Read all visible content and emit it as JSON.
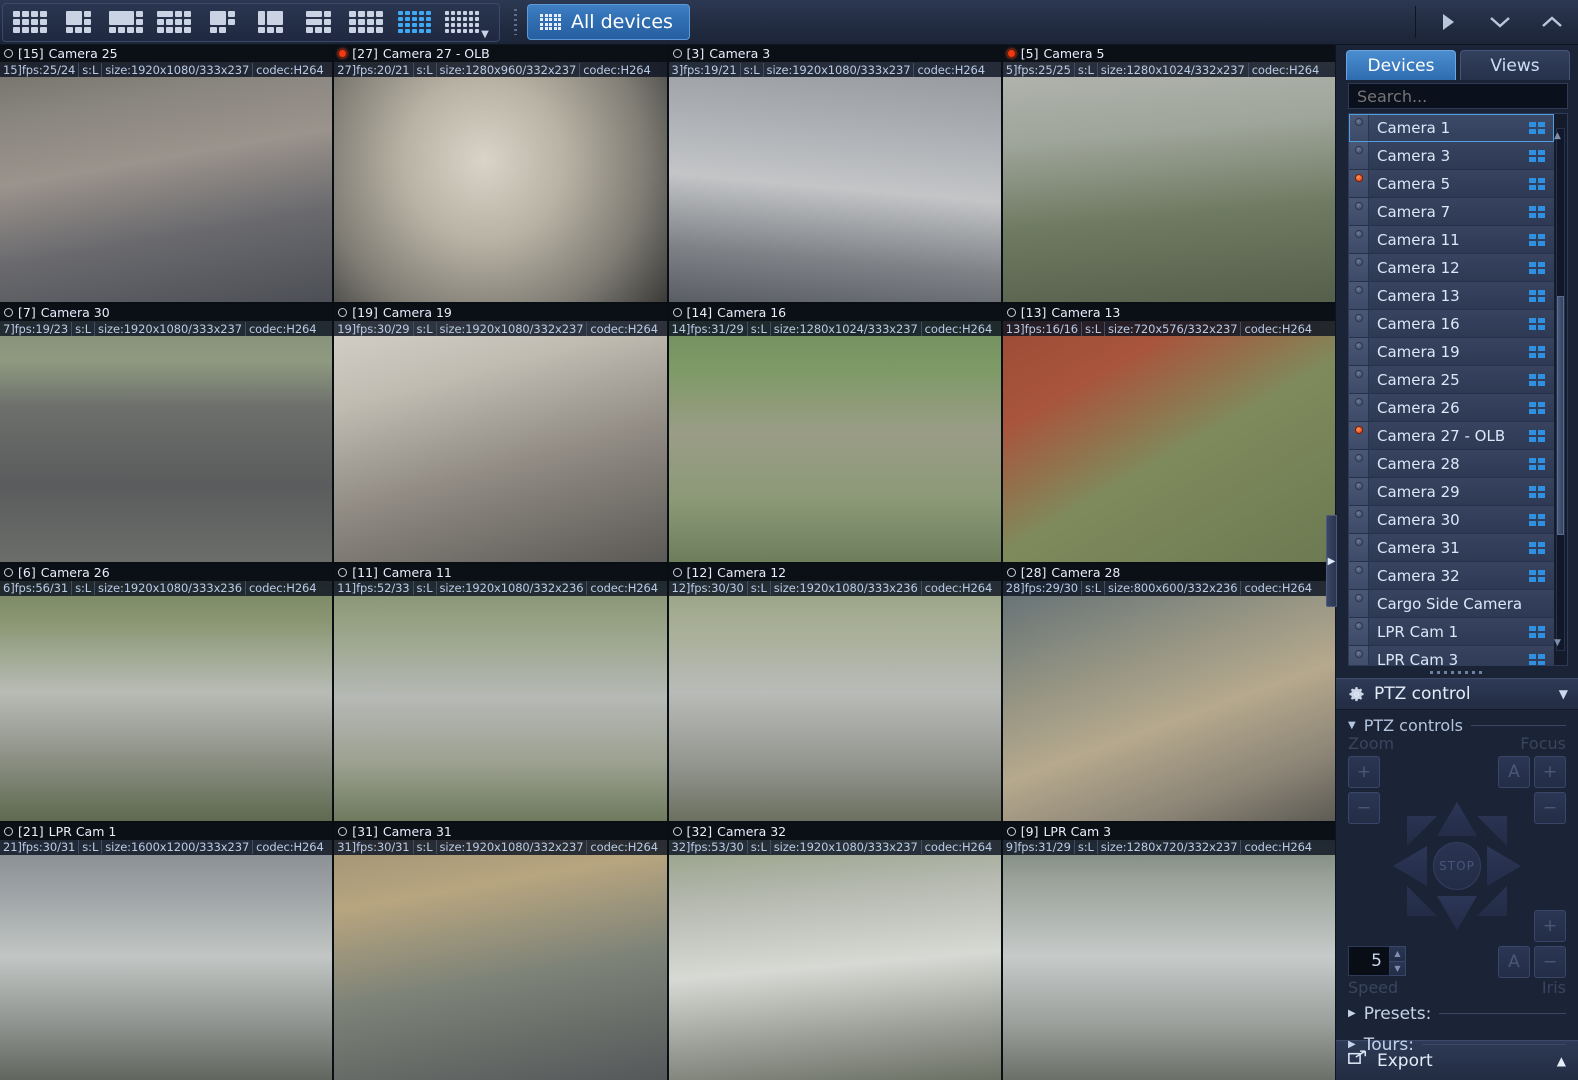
{
  "toolbar": {
    "layout_buttons": [
      {
        "name": "layout-4x3",
        "cols": 4,
        "rows": 3,
        "active": false
      },
      {
        "name": "layout-1plus5",
        "cols": 3,
        "rows": 3,
        "active": false
      },
      {
        "name": "layout-1plus7",
        "cols": 4,
        "rows": 3,
        "active": false
      },
      {
        "name": "layout-3x4-mixed",
        "cols": 4,
        "rows": 3,
        "active": false
      },
      {
        "name": "layout-1plus3",
        "cols": 3,
        "rows": 3,
        "active": false
      },
      {
        "name": "layout-2plus4",
        "cols": 3,
        "rows": 3,
        "active": false
      },
      {
        "name": "layout-2x2-mixed",
        "cols": 3,
        "rows": 3,
        "active": false
      },
      {
        "name": "layout-3x3",
        "cols": 4,
        "rows": 3,
        "active": false
      },
      {
        "name": "layout-4x4",
        "cols": 5,
        "rows": 4,
        "active": true
      },
      {
        "name": "layout-more",
        "cols": 6,
        "rows": 4,
        "active": false
      }
    ],
    "all_devices_label": "All devices",
    "play_icon": "play-icon",
    "collapse_down_icon": "chevron-down-icon",
    "collapse_up_icon": "chevron-up-icon",
    "accent": "#2f6cb0",
    "active_layout_color": "#3fa9f5"
  },
  "video_grid": {
    "rows": 4,
    "cols": 4,
    "cells": [
      {
        "channel": "[15]",
        "title": "Camera 25",
        "recording": false,
        "selected": false,
        "stats": [
          "15]fps:25/24",
          "s:L",
          "size:1920x1080/333x237",
          "codec:H264"
        ],
        "stats_full": "[15]fps:25/24 |s:L|size:1920x1080/333x237 |codec:H264",
        "scene": "escalator-crowd"
      },
      {
        "channel": "[27]",
        "title": "Camera 27 - OLB",
        "recording": true,
        "selected": false,
        "stats": [
          "27]fps:20/21",
          "s:L",
          "size:1280x960/332x237",
          "codec:H264"
        ],
        "stats_full": "[27]fps:20/21 |s:L|size:1280x960/332x237 |codec:H264",
        "scene": "fisheye-lobby"
      },
      {
        "channel": "[3]",
        "title": "Camera 3",
        "recording": false,
        "selected": false,
        "stats": [
          "3]fps:19/21",
          "s:L",
          "size:1920x1080/333x237",
          "codec:H264"
        ],
        "stats_full": "[3]fps:19/21 |s:L|size:1920x1080/333x237 |codec:H264",
        "scene": "street-pickup"
      },
      {
        "channel": "[5]",
        "title": "Camera 5",
        "recording": true,
        "selected": false,
        "stats": [
          "5]fps:25/25",
          "s:L",
          "size:1280x1024/332x237",
          "codec:H264"
        ],
        "stats_full": "[5]fps:25/25 |s:L|size:1280x1024/332x237 |codec:H264",
        "scene": "building-parking"
      },
      {
        "channel": "[7]",
        "title": "Camera 30",
        "recording": false,
        "selected": false,
        "stats": [
          "7]fps:19/23",
          "s:L",
          "size:1920x1080/333x237",
          "codec:H264"
        ],
        "stats_full": "[7]fps:19/23 |s:L|size:1920x1080/333x237 |codec:H264",
        "scene": "highway"
      },
      {
        "channel": "[19]",
        "title": "Camera 19",
        "recording": false,
        "selected": false,
        "stats": [
          "19]fps:30/29",
          "s:L",
          "size:1920x1080/332x237",
          "codec:H264"
        ],
        "stats_full": "[19]fps:30/29 |s:L|size:1920x1080/332x237 |codec:H264",
        "scene": "indoor-people"
      },
      {
        "channel": "[14]",
        "title": "Camera 16",
        "recording": false,
        "selected": false,
        "stats": [
          "14]fps:31/29",
          "s:L",
          "size:1280x1024/333x237",
          "codec:H264"
        ],
        "stats_full": "[14]fps:31/29 |s:L|size:1280x1024/333x237 |codec:H264",
        "scene": "promenade-crowd"
      },
      {
        "channel": "[13]",
        "title": "Camera 13",
        "recording": false,
        "selected": false,
        "stats": [
          "13]fps:16/16",
          "s:L",
          "size:720x576/332x237",
          "codec:H264"
        ],
        "stats_full": "[13]fps:16/16 |s:L|size:720x576/332x237 |codec:H264",
        "scene": "red-building-walk"
      },
      {
        "channel": "[6]",
        "title": "Camera 26",
        "recording": false,
        "selected": false,
        "stats": [
          "6]fps:56/31",
          "s:L",
          "size:1920x1080/333x236",
          "codec:H264"
        ],
        "stats_full": "[6]fps:56/31 |s:L|size:1920x1080/333x236 |codec:H264",
        "scene": "truck-trailer"
      },
      {
        "channel": "[11]",
        "title": "Camera 11",
        "recording": false,
        "selected": false,
        "stats": [
          "11]fps:52/33",
          "s:L",
          "size:1920x1080/332x236",
          "codec:H264"
        ],
        "stats_full": "[11]fps:52/33 |s:L|size:1920x1080/332x236 |codec:H264",
        "scene": "suburban-road"
      },
      {
        "channel": "[12]",
        "title": "Camera 12",
        "recording": false,
        "selected": false,
        "stats": [
          "12]fps:30/30",
          "s:L",
          "size:1920x1080/333x236",
          "codec:H264"
        ],
        "stats_full": "[12]fps:30/30 |s:L|size:1920x1080/333x236 |codec:H264",
        "scene": "intersection-cars"
      },
      {
        "channel": "[28]",
        "title": "Camera 28",
        "recording": false,
        "selected": false,
        "stats": [
          "28]fps:29/30",
          "s:L",
          "size:800x600/332x236",
          "codec:H264"
        ],
        "stats_full": "[28]fps:29/30 |s:L|size:800x600/332x236 |codec:H264",
        "scene": "barrier-gate"
      },
      {
        "channel": "[21]",
        "title": "LPR Cam 1",
        "recording": false,
        "selected": false,
        "stats": [
          "21]fps:30/31",
          "s:L",
          "size:1600x1200/333x237",
          "codec:H264"
        ],
        "stats_full": "[21]fps:30/31 |s:L|size:1600x1200/333x237 |codec:H264",
        "scene": "white-suv-sign"
      },
      {
        "channel": "[31]",
        "title": "Camera 31",
        "recording": false,
        "selected": false,
        "stats": [
          "31]fps:30/31",
          "s:L",
          "size:1920x1080/332x237",
          "codec:H264"
        ],
        "stats_full": "[31]fps:30/31 |s:L|size:1920x1080/332x237 |codec:H264",
        "scene": "checkpoint-b"
      },
      {
        "channel": "[32]",
        "title": "Camera 32",
        "recording": false,
        "selected": false,
        "stats": [
          "32]fps:53/30",
          "s:L",
          "size:1920x1080/333x237",
          "codec:H264"
        ],
        "stats_full": "[32]fps:53/30 |s:L|size:1920x1080/333x237 |codec:H264",
        "scene": "delivery-truck"
      },
      {
        "channel": "[9]",
        "title": "LPR Cam 3",
        "recording": false,
        "selected": false,
        "stats": [
          "9]fps:31/29",
          "s:L",
          "size:1280x720/332x237",
          "codec:H264"
        ],
        "stats_full": "[9]fps:31/29 |s:L|size:1280x720/332x237 |codec:H264",
        "scene": "silver-sedan-plate"
      }
    ]
  },
  "sidebar": {
    "tabs": [
      {
        "label": "Devices",
        "active": true
      },
      {
        "label": "Views",
        "active": false
      }
    ],
    "search_placeholder": "Search...",
    "devices": [
      {
        "label": "Camera 1",
        "recording": false,
        "selected": true,
        "has_icon": true
      },
      {
        "label": "Camera 3",
        "recording": false,
        "selected": false,
        "has_icon": true
      },
      {
        "label": "Camera 5",
        "recording": true,
        "selected": false,
        "has_icon": true
      },
      {
        "label": "Camera 7",
        "recording": false,
        "selected": false,
        "has_icon": true
      },
      {
        "label": "Camera 11",
        "recording": false,
        "selected": false,
        "has_icon": true
      },
      {
        "label": "Camera 12",
        "recording": false,
        "selected": false,
        "has_icon": true
      },
      {
        "label": "Camera 13",
        "recording": false,
        "selected": false,
        "has_icon": true
      },
      {
        "label": "Camera 16",
        "recording": false,
        "selected": false,
        "has_icon": true
      },
      {
        "label": "Camera 19",
        "recording": false,
        "selected": false,
        "has_icon": true
      },
      {
        "label": "Camera 25",
        "recording": false,
        "selected": false,
        "has_icon": true
      },
      {
        "label": "Camera 26",
        "recording": false,
        "selected": false,
        "has_icon": true
      },
      {
        "label": "Camera 27 - OLB",
        "recording": true,
        "selected": false,
        "has_icon": true
      },
      {
        "label": "Camera 28",
        "recording": false,
        "selected": false,
        "has_icon": true
      },
      {
        "label": "Camera 29",
        "recording": false,
        "selected": false,
        "has_icon": true
      },
      {
        "label": "Camera 30",
        "recording": false,
        "selected": false,
        "has_icon": true
      },
      {
        "label": "Camera 31",
        "recording": false,
        "selected": false,
        "has_icon": true
      },
      {
        "label": "Camera 32",
        "recording": false,
        "selected": false,
        "has_icon": true
      },
      {
        "label": "Cargo Side Camera",
        "recording": false,
        "selected": false,
        "has_icon": false
      },
      {
        "label": "LPR Cam 1",
        "recording": false,
        "selected": false,
        "has_icon": true
      },
      {
        "label": "LPR Cam 3",
        "recording": false,
        "selected": false,
        "has_icon": true
      }
    ],
    "ptz": {
      "header": "PTZ control",
      "header_icon": "gear-icon",
      "section": "PTZ controls",
      "zoom_label": "Zoom",
      "zoom_in": "+",
      "zoom_out": "−",
      "focus_label": "Focus",
      "focus_auto": "A",
      "focus_in": "+",
      "focus_out": "−",
      "stop_label": "STOP",
      "speed_value": "5",
      "speed_label": "Speed",
      "iris_label": "Iris",
      "iris_auto": "A",
      "iris_in": "+",
      "iris_out": "−",
      "presets_label": "Presets:",
      "tours_label": "Tours:"
    },
    "export": {
      "label": "Export",
      "icon": "export-icon",
      "caret": "▲"
    }
  }
}
